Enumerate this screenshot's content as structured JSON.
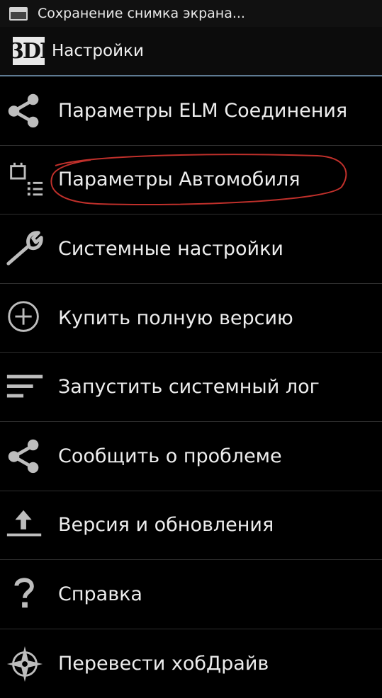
{
  "status_bar": {
    "text": "Сохранение снимка экрана..."
  },
  "action_bar": {
    "logo_text": "3DI",
    "title": "Настройки"
  },
  "menu": {
    "items": [
      {
        "label": "Параметры ELM Соединения",
        "icon": "share-icon"
      },
      {
        "label": "Параметры Автомобиля",
        "icon": "car-params-icon",
        "highlighted": true
      },
      {
        "label": "Системные настройки",
        "icon": "wrench-icon"
      },
      {
        "label": "Купить полную версию",
        "icon": "plus-circle-icon"
      },
      {
        "label": "Запустить системный лог",
        "icon": "log-lines-icon"
      },
      {
        "label": "Сообщить о проблеме",
        "icon": "share-icon"
      },
      {
        "label": "Версия и обновления",
        "icon": "upload-icon"
      },
      {
        "label": "Справка",
        "icon": "help-icon"
      },
      {
        "label": "Перевести хобДрайв",
        "icon": "compass-icon"
      }
    ]
  },
  "colors": {
    "highlight_circle": "#c0302b",
    "actionbar_divider": "#5f7b93"
  }
}
